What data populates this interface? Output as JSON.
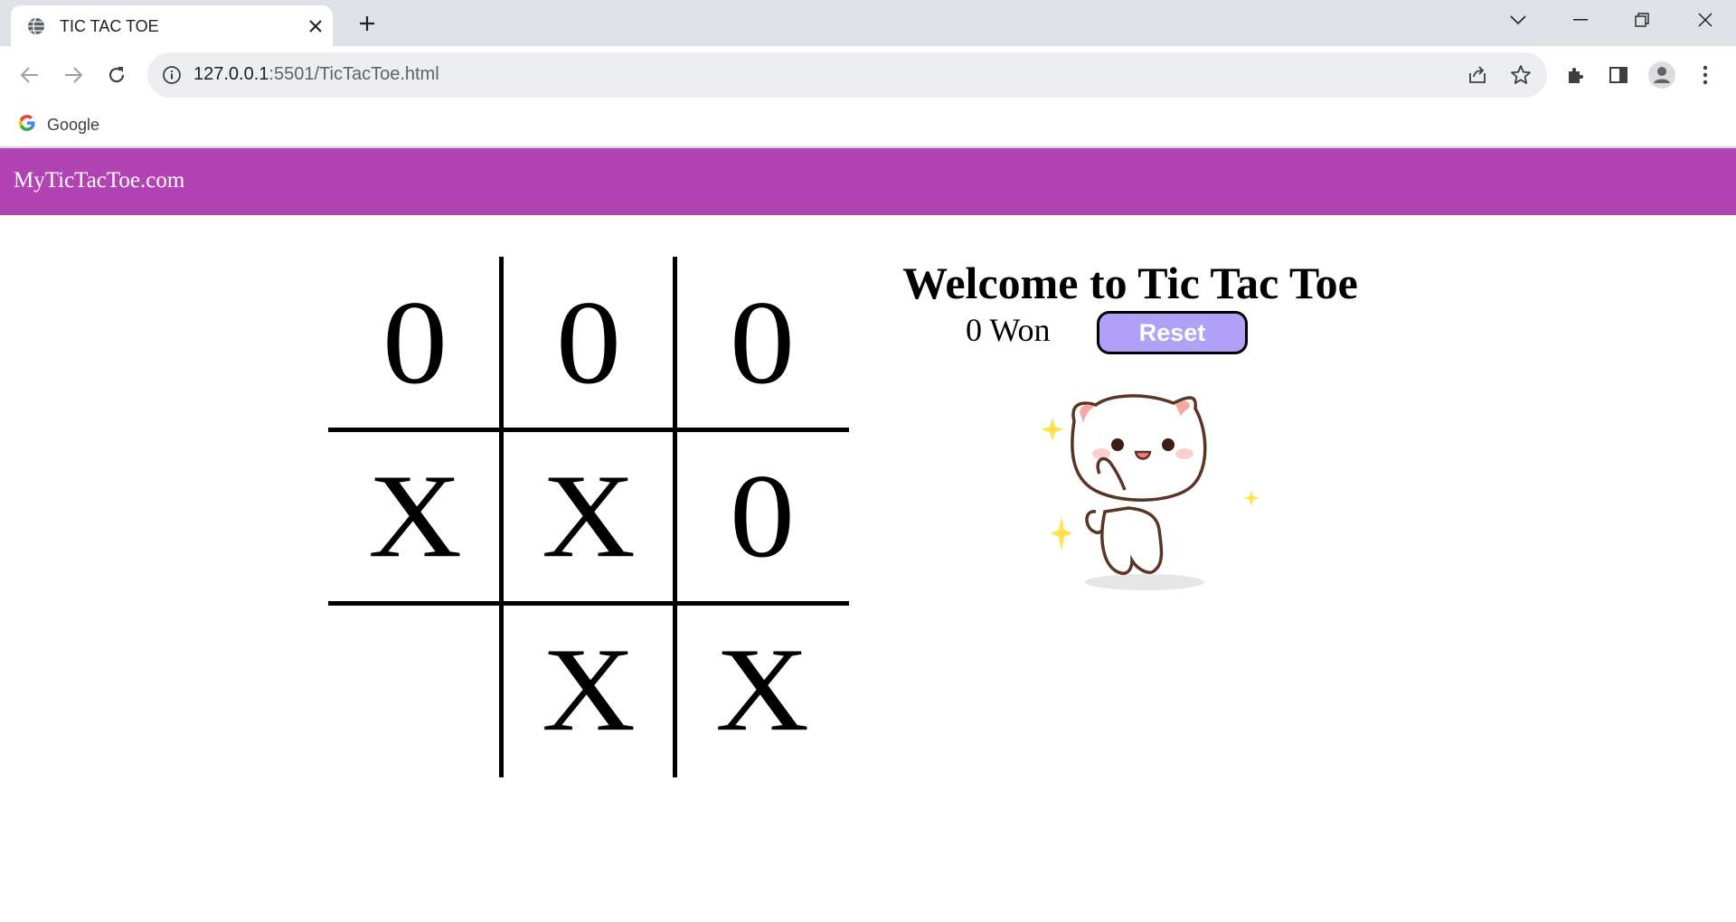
{
  "browser": {
    "tab_title": "TIC TAC TOE",
    "url_host": "127.0.0.1",
    "url_rest": ":5501/TicTacToe.html",
    "bookmark_label": "Google"
  },
  "site": {
    "brand": "MyTicTacToe.com"
  },
  "game": {
    "title": "Welcome to Tic Tac Toe",
    "status": "0 Won",
    "reset_label": "Reset",
    "board": [
      "0",
      "0",
      "0",
      "X",
      "X",
      "0",
      "",
      "X",
      "X"
    ]
  },
  "icons": {
    "tab_favicon": "globe-icon",
    "tab_close": "close-icon",
    "new_tab": "plus-icon",
    "back": "arrow-left-icon",
    "forward": "arrow-right-icon",
    "reload": "reload-icon",
    "site_info": "info-icon",
    "share": "share-icon",
    "bookmark_star": "star-icon",
    "extensions": "puzzle-icon",
    "side_panel": "side-panel-icon",
    "profile": "profile-icon",
    "menu": "kebab-menu-icon",
    "mascot": "cat-sticker-image"
  },
  "colors": {
    "navbar": "#b143b3",
    "reset_button": "#b1a0f8"
  }
}
